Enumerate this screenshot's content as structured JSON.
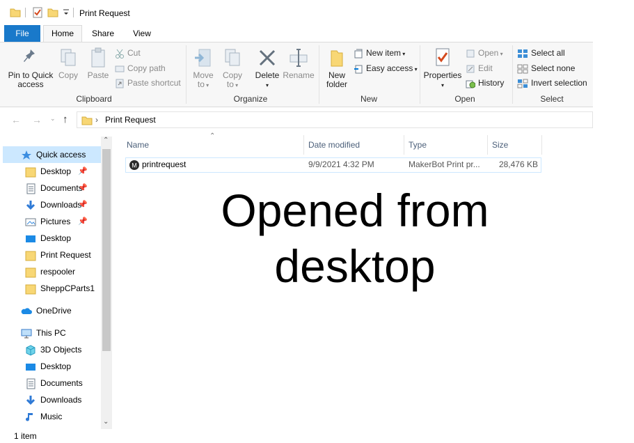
{
  "window": {
    "title": "Print Request"
  },
  "tabs": [
    {
      "label": "File"
    },
    {
      "label": "Home"
    },
    {
      "label": "Share"
    },
    {
      "label": "View"
    }
  ],
  "ribbon": {
    "clipboard": {
      "label": "Clipboard",
      "pin": [
        "Pin to Quick",
        "access"
      ],
      "copy": "Copy",
      "paste": "Paste",
      "cut": "Cut",
      "copy_path": "Copy path",
      "paste_shortcut": "Paste shortcut"
    },
    "organize": {
      "label": "Organize",
      "move_to": [
        "Move",
        "to"
      ],
      "copy_to": [
        "Copy",
        "to"
      ],
      "delete": "Delete",
      "rename": "Rename"
    },
    "new": {
      "label": "New",
      "new_folder": [
        "New",
        "folder"
      ],
      "new_item": "New item",
      "easy_access": "Easy access"
    },
    "open": {
      "label": "Open",
      "properties": "Properties",
      "open": "Open",
      "edit": "Edit",
      "history": "History"
    },
    "select": {
      "label": "Select",
      "select_all": "Select all",
      "select_none": "Select none",
      "invert": "Invert selection"
    }
  },
  "address": {
    "path": "Print Request"
  },
  "sidebar": {
    "quick_access": "Quick access",
    "quick_items": [
      {
        "label": "Desktop",
        "pinned": true
      },
      {
        "label": "Documents",
        "pinned": true
      },
      {
        "label": "Downloads",
        "pinned": true
      },
      {
        "label": "Pictures",
        "pinned": true
      },
      {
        "label": "Desktop",
        "pinned": false
      },
      {
        "label": "Print Request",
        "pinned": false
      },
      {
        "label": "respooler",
        "pinned": false
      },
      {
        "label": "SheppCParts1",
        "pinned": false
      }
    ],
    "onedrive": "OneDrive",
    "this_pc": "This PC",
    "pc_items": [
      {
        "label": "3D Objects"
      },
      {
        "label": "Desktop"
      },
      {
        "label": "Documents"
      },
      {
        "label": "Downloads"
      },
      {
        "label": "Music"
      }
    ]
  },
  "columns": {
    "name": "Name",
    "date": "Date modified",
    "type": "Type",
    "size": "Size"
  },
  "files": [
    {
      "name": "printrequest",
      "date": "9/9/2021 4:32 PM",
      "type": "MakerBot Print pr...",
      "size": "28,476 KB"
    }
  ],
  "overlay": {
    "line1": "Opened from",
    "line2": "desktop"
  },
  "status": {
    "count": "1 item"
  },
  "colors": {
    "file_tab": "#1979ca",
    "accent": "#0078d7",
    "folder": "#f8d775",
    "header_text": "#4c607a"
  }
}
